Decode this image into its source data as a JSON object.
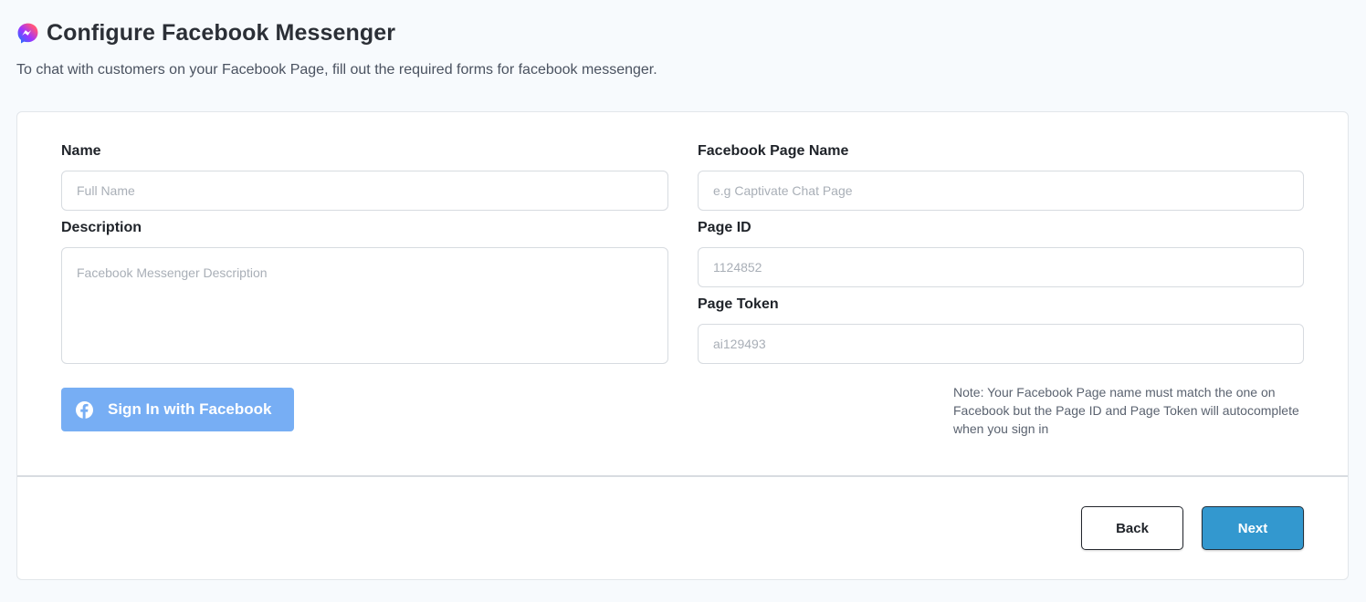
{
  "header": {
    "title": "Configure Facebook Messenger",
    "subtitle": "To chat with customers on your Facebook Page, fill out the required forms for facebook messenger."
  },
  "form": {
    "name": {
      "label": "Name",
      "value": "",
      "placeholder": "Full Name"
    },
    "description": {
      "label": "Description",
      "value": "",
      "placeholder": "Facebook Messenger Description"
    },
    "page_name": {
      "label": "Facebook Page Name",
      "value": "",
      "placeholder": "e.g Captivate Chat Page"
    },
    "page_id": {
      "label": "Page ID",
      "value": "",
      "placeholder": "1124852"
    },
    "page_token": {
      "label": "Page Token",
      "value": "",
      "placeholder": "ai129493"
    },
    "signin_label": "Sign In with Facebook",
    "note": "Note: Your Facebook Page name must match the one on Facebook but the Page ID and Page Token will autocomplete when you sign in"
  },
  "footer": {
    "back_label": "Back",
    "next_label": "Next"
  },
  "icons": {
    "header": "messenger-icon",
    "signin": "facebook-icon"
  },
  "colors": {
    "signin_button": "#77aef4",
    "next_button": "#3398cf",
    "page_background": "#f7fafd"
  }
}
